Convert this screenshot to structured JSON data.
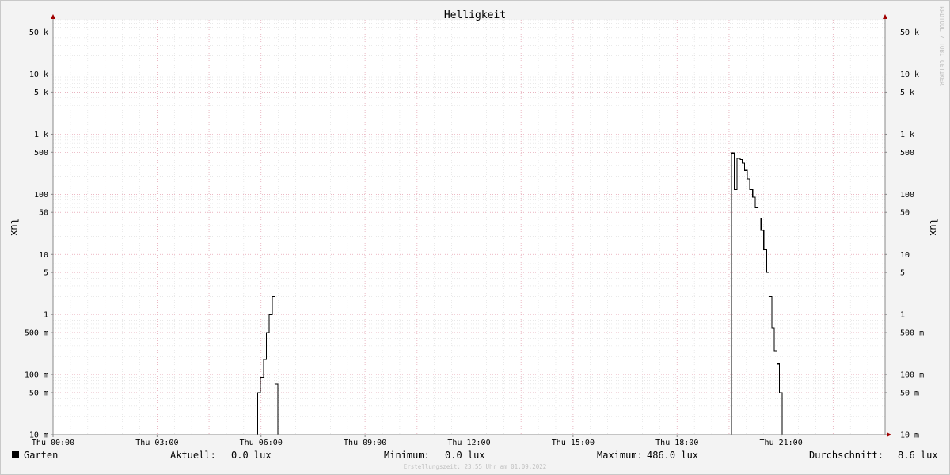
{
  "chart_data": {
    "type": "line",
    "title": "Helligkeit",
    "ylabel": "lux",
    "yscale": "log",
    "ylim": [
      0.01,
      80000
    ],
    "y_ticks": [
      {
        "value": 0.01,
        "label": "10 m"
      },
      {
        "value": 0.05,
        "label": "50 m"
      },
      {
        "value": 0.1,
        "label": "100 m"
      },
      {
        "value": 0.5,
        "label": "500 m"
      },
      {
        "value": 1,
        "label": "1"
      },
      {
        "value": 5,
        "label": "5"
      },
      {
        "value": 10,
        "label": "10"
      },
      {
        "value": 50,
        "label": "50"
      },
      {
        "value": 100,
        "label": "100"
      },
      {
        "value": 500,
        "label": "500"
      },
      {
        "value": 1000,
        "label": "1 k"
      },
      {
        "value": 5000,
        "label": "5 k"
      },
      {
        "value": 10000,
        "label": "10 k"
      },
      {
        "value": 50000,
        "label": "50 k"
      }
    ],
    "xlim": [
      0,
      24
    ],
    "x_ticks": [
      {
        "value": 0,
        "label": "Thu 00:00"
      },
      {
        "value": 3,
        "label": "Thu 03:00"
      },
      {
        "value": 6,
        "label": "Thu 06:00"
      },
      {
        "value": 9,
        "label": "Thu 09:00"
      },
      {
        "value": 12,
        "label": "Thu 12:00"
      },
      {
        "value": 15,
        "label": "Thu 15:00"
      },
      {
        "value": 18,
        "label": "Thu 18:00"
      },
      {
        "value": 21,
        "label": "Thu 21:00"
      }
    ],
    "grid": true,
    "series": [
      {
        "name": "Garten",
        "color": "#000000",
        "x": [
          0,
          5.9,
          5.9,
          5.98,
          6.07,
          6.15,
          6.23,
          6.32,
          6.4,
          6.48,
          6.48,
          24
        ],
        "y": [
          0.01,
          0.01,
          0.05,
          0.09,
          0.18,
          0.5,
          1.0,
          2.0,
          0.07,
          0.07,
          0.01,
          0.01
        ]
      },
      {
        "name": "",
        "color": "#000000",
        "x": [
          0,
          19.57,
          19.57,
          19.65,
          19.65,
          19.73,
          19.82,
          19.88,
          19.95,
          20.03,
          20.1,
          20.18,
          20.25,
          20.33,
          20.42,
          20.5,
          20.58,
          20.65,
          20.73,
          20.8,
          20.88,
          20.95,
          21.03,
          21.03,
          24
        ],
        "y": [
          0.01,
          0.01,
          486,
          486,
          120,
          400,
          380,
          330,
          250,
          180,
          120,
          90,
          60,
          40,
          25,
          12,
          5,
          2,
          0.6,
          0.25,
          0.15,
          0.05,
          0.05,
          0.01,
          0.01
        ]
      }
    ],
    "legend": {
      "series": "Garten",
      "aktuell_label": "Aktuell:",
      "aktuell_value": "0.0 lux",
      "minimum_label": "Minimum:",
      "minimum_value": "0.0 lux",
      "maximum_label": "Maximum:",
      "maximum_value": "486.0 lux",
      "durchschnitt_label": "Durchschnitt:",
      "durchschnitt_value": "8.6 lux"
    },
    "watermark": "RRDTOOL / TOBI OETIKER",
    "footer": "Erstellungszeit: 23:55 Uhr am 01.09.2022"
  }
}
